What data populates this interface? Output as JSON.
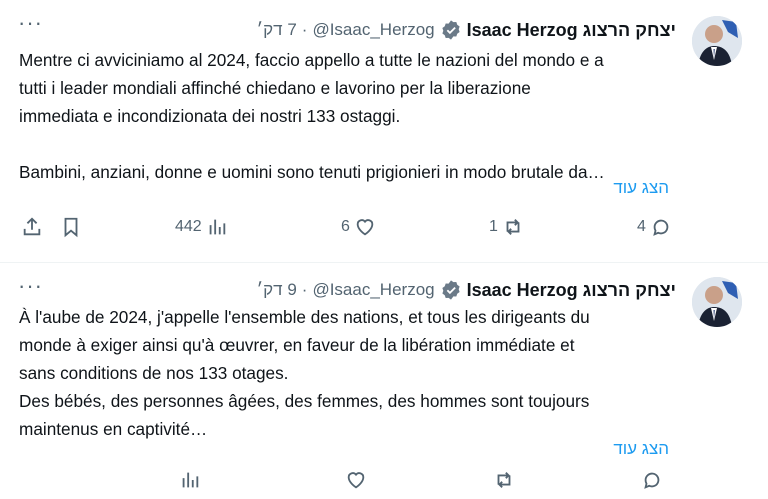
{
  "tweets": [
    {
      "name": "יצחק הרצוג Isaac Herzog",
      "handle": "@Isaac_Herzog",
      "time": "7 דק׳",
      "text": "Mentre ci avviciniamo al 2024, faccio appello a tutte le nazioni del mondo e a\ntutti i leader mondiali affinché chiedano e lavorino per la liberazione\nimmediata e incondizionata dei nostri 133 ostaggi.\n\nBambini, anziani, donne e uomini sono tenuti prigionieri in modo brutale da…",
      "show_more": "הצג עוד",
      "views": "442",
      "likes": "6",
      "retweets": "1",
      "replies": "4"
    },
    {
      "name": "יצחק הרצוג Isaac Herzog",
      "handle": "@Isaac_Herzog",
      "time": "9 דק׳",
      "text": "À l'aube de 2024, j'appelle l'ensemble des nations, et tous les dirigeants du\nmonde à exiger ainsi qu'à œuvrer, en faveur de la libération immédiate et\nsans conditions de nos 133 otages.\nDes bébés, des personnes âgées, des femmes, des hommes sont toujours\nmaintenus en captivité…",
      "show_more": "הצג עוד",
      "views": "",
      "likes": "",
      "retweets": "",
      "replies": ""
    }
  ],
  "icons": {
    "more": "more-icon",
    "verified": "verified-badge-icon",
    "share": "share-icon",
    "bookmark": "bookmark-icon",
    "views": "views-icon",
    "like": "heart-icon",
    "retweet": "retweet-icon",
    "reply": "reply-icon"
  },
  "colors": {
    "accent": "#1d9bf0",
    "muted": "#536471",
    "text": "#0f1419"
  }
}
